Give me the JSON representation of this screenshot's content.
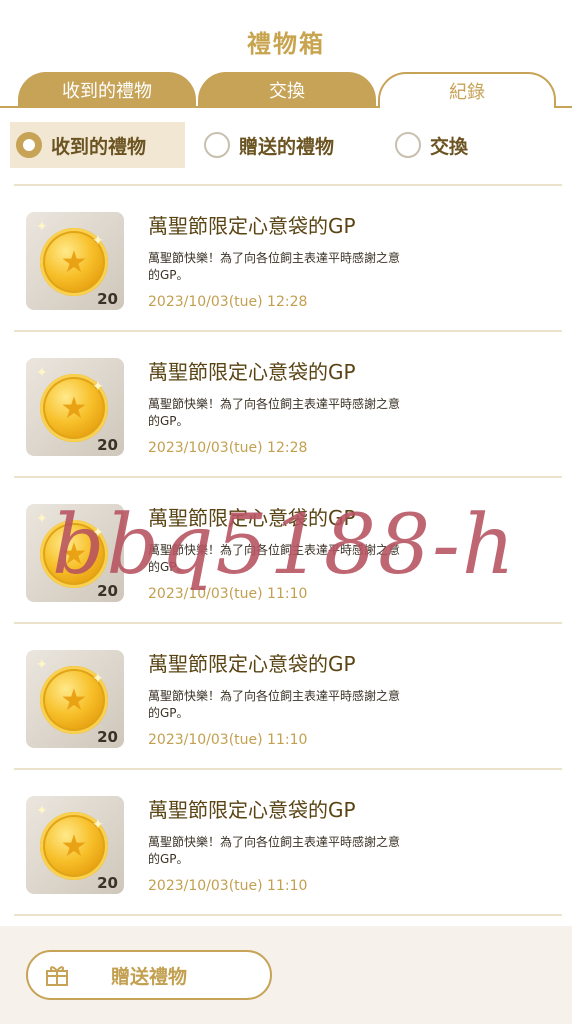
{
  "header": {
    "title": "禮物箱"
  },
  "tabs": [
    {
      "label": "收到的禮物"
    },
    {
      "label": "交換"
    },
    {
      "label": "紀錄"
    }
  ],
  "filters": [
    {
      "label": "收到的禮物",
      "selected": true
    },
    {
      "label": "贈送的禮物",
      "selected": false
    },
    {
      "label": "交換",
      "selected": false
    }
  ],
  "items": [
    {
      "title": "萬聖節限定心意袋的GP",
      "desc": "萬聖節快樂！為了向各位飼主表達平時感謝之意的GP。",
      "time": "2023/10/03(tue) 12:28",
      "qty": "20"
    },
    {
      "title": "萬聖節限定心意袋的GP",
      "desc": "萬聖節快樂！為了向各位飼主表達平時感謝之意的GP。",
      "time": "2023/10/03(tue) 12:28",
      "qty": "20"
    },
    {
      "title": "萬聖節限定心意袋的GP",
      "desc": "萬聖節快樂！為了向各位飼主表達平時感謝之意的GP。",
      "time": "2023/10/03(tue) 11:10",
      "qty": "20"
    },
    {
      "title": "萬聖節限定心意袋的GP",
      "desc": "萬聖節快樂！為了向各位飼主表達平時感謝之意的GP。",
      "time": "2023/10/03(tue) 11:10",
      "qty": "20"
    },
    {
      "title": "萬聖節限定心意袋的GP",
      "desc": "萬聖節快樂！為了向各位飼主表達平時感謝之意的GP。",
      "time": "2023/10/03(tue) 11:10",
      "qty": "20"
    }
  ],
  "watermark": "bbq5188-h",
  "footer": {
    "send_label": "贈送禮物"
  },
  "colors": {
    "gold": "#c6a357",
    "brown": "#6b5422",
    "active_bg": "#f1e7d3",
    "watermark": "#b75260"
  }
}
